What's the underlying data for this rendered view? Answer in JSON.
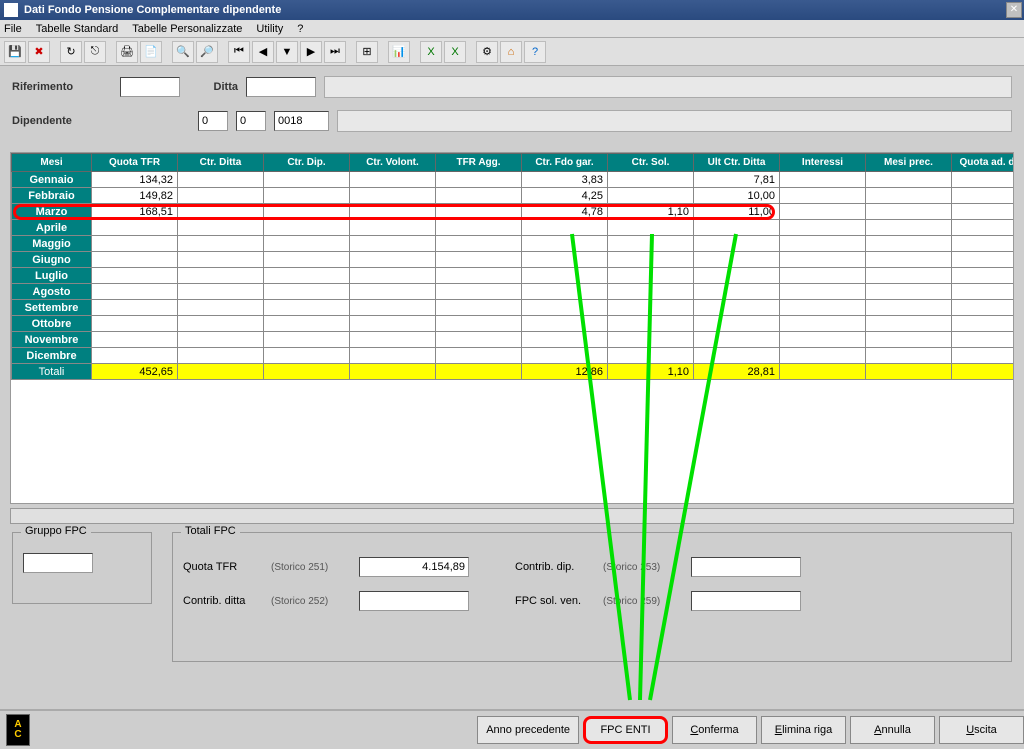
{
  "window": {
    "title": "Dati Fondo Pensione Complementare dipendente"
  },
  "menu": {
    "file": "File",
    "tab_std": "Tabelle Standard",
    "tab_pers": "Tabelle Personalizzate",
    "utility": "Utility",
    "help": "?"
  },
  "form": {
    "riferimento_label": "Riferimento",
    "riferimento": "",
    "ditta_label": "Ditta",
    "ditta": "",
    "ditta_desc": "",
    "dipendente_label": "Dipendente",
    "dip1": "0",
    "dip2": "0",
    "dip3": "0018",
    "dip_desc": ""
  },
  "grid": {
    "headers": [
      "Mesi",
      "Quota TFR",
      "Ctr. Ditta",
      "Ctr. Dip.",
      "Ctr. Volont.",
      "TFR Agg.",
      "Ctr. Fdo gar.",
      "Ctr. Sol.",
      "Ult Ctr. Ditta",
      "Interessi",
      "Mesi prec.",
      "Quota ad. ditta"
    ],
    "months": [
      "Gennaio",
      "Febbraio",
      "Marzo",
      "Aprile",
      "Maggio",
      "Giugno",
      "Luglio",
      "Agosto",
      "Settembre",
      "Ottobre",
      "Novembre",
      "Dicembre"
    ],
    "rows": [
      {
        "quota_tfr": "134,32",
        "ctr_fdo": "3,83",
        "ctr_sol": "",
        "ult_ctr": "7,81"
      },
      {
        "quota_tfr": "149,82",
        "ctr_fdo": "4,25",
        "ctr_sol": "",
        "ult_ctr": "10,00"
      },
      {
        "quota_tfr": "168,51",
        "ctr_fdo": "4,78",
        "ctr_sol": "1,10",
        "ult_ctr": "11,00"
      },
      {},
      {},
      {},
      {},
      {},
      {},
      {},
      {},
      {}
    ],
    "totals_label": "Totali",
    "totals": {
      "quota_tfr": "452,65",
      "ctr_fdo": "12,86",
      "ctr_sol": "1,10",
      "ult_ctr": "28,81"
    }
  },
  "gruppo": {
    "title": "Gruppo FPC",
    "value": ""
  },
  "totali": {
    "title": "Totali FPC",
    "quota_tfr_label": "Quota TFR",
    "quota_tfr_stor": "(Storico 251)",
    "quota_tfr_val": "4.154,89",
    "contrib_dip_label": "Contrib. dip.",
    "contrib_dip_stor": "(Storico 253)",
    "contrib_dip_val": "",
    "contrib_ditta_label": "Contrib. ditta",
    "contrib_ditta_stor": "(Storico 252)",
    "contrib_ditta_val": "",
    "fpc_sol_label": "FPC sol. ven.",
    "fpc_sol_stor": "(Storico 259)",
    "fpc_sol_val": ""
  },
  "buttons": {
    "anno_prec": "Anno precedente",
    "fpc_enti": "FPC ENTI",
    "conferma": "Conferma",
    "elimina": "Elimina riga",
    "annulla": "Annulla",
    "uscita": "Uscita"
  },
  "ac": {
    "a": "A",
    "c": "C"
  }
}
